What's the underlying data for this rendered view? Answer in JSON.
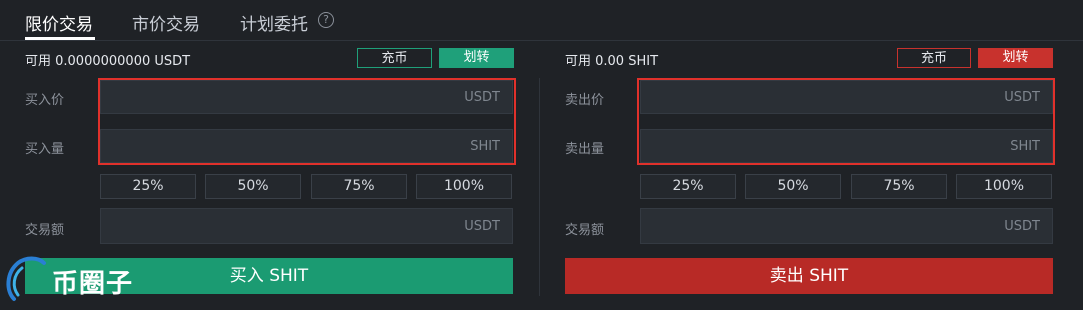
{
  "tabs": [
    {
      "label": "限价交易",
      "active": true
    },
    {
      "label": "市价交易",
      "active": false
    },
    {
      "label": "计划委托",
      "active": false
    }
  ],
  "buy": {
    "available": "可用 0.0000000000 USDT",
    "recharge": "充币",
    "transfer": "划转",
    "price_label": "买入价",
    "price_unit": "USDT",
    "amount_label": "买入量",
    "amount_unit": "SHIT",
    "percents": [
      "25%",
      "50%",
      "75%",
      "100%"
    ],
    "total_label": "交易额",
    "total_unit": "USDT",
    "action": "买入 SHIT"
  },
  "sell": {
    "available": "可用 0.00 SHIT",
    "recharge": "充币",
    "transfer": "划转",
    "price_label": "卖出价",
    "price_unit": "USDT",
    "amount_label": "卖出量",
    "amount_unit": "SHIT",
    "percents": [
      "25%",
      "50%",
      "75%",
      "100%"
    ],
    "total_label": "交易额",
    "total_unit": "USDT",
    "action": "卖出 SHIT"
  },
  "watermark": {
    "text": "币圈子"
  },
  "colors": {
    "buy": "#1b9b72",
    "sell": "#b82a26",
    "highlight": "#e0312b"
  }
}
